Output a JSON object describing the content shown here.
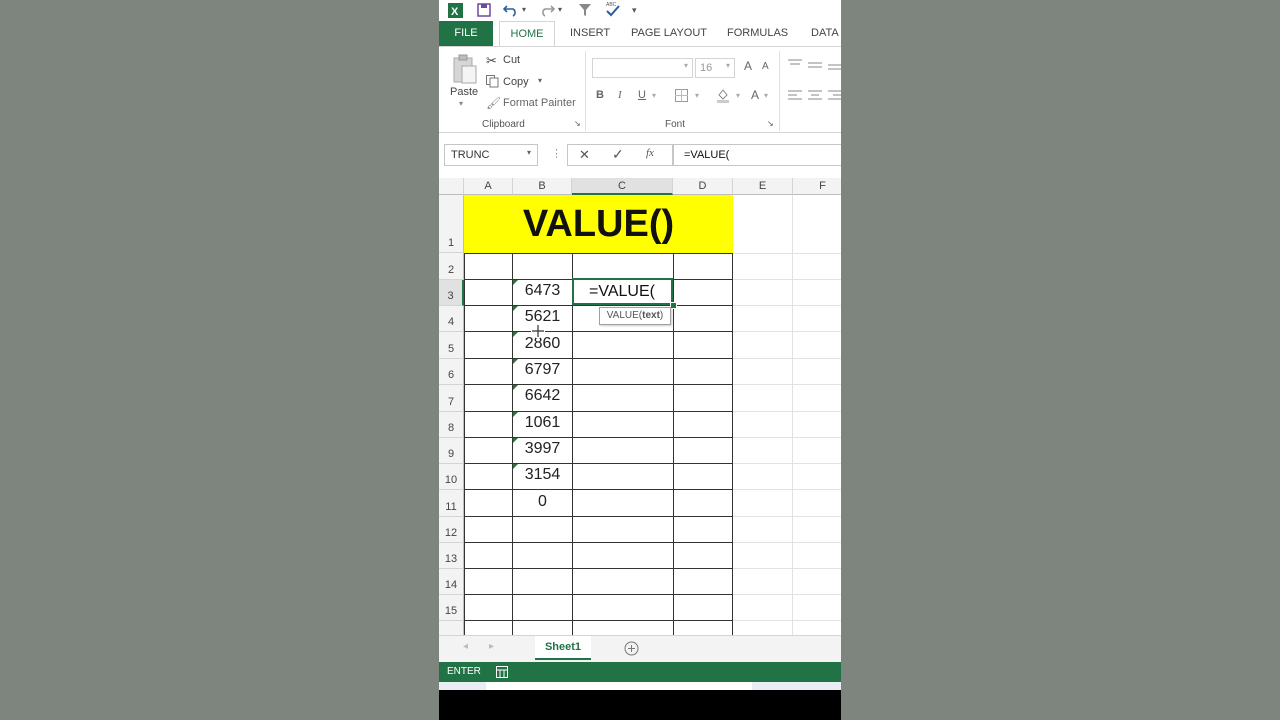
{
  "quick_access": {
    "excel_icon": "excel-logo-icon",
    "customize": "▾"
  },
  "tabs": [
    {
      "label": "FILE"
    },
    {
      "label": "HOME"
    },
    {
      "label": "INSERT"
    },
    {
      "label": "PAGE LAYOUT"
    },
    {
      "label": "FORMULAS"
    },
    {
      "label": "DATA"
    }
  ],
  "clipboard": {
    "paste": "Paste",
    "cut": "Cut",
    "copy": "Copy",
    "format_painter": "Format Painter",
    "group": "Clipboard"
  },
  "font": {
    "name": "",
    "size": "16",
    "bold": "B",
    "italic": "I",
    "underline": "U",
    "group": "Font",
    "grow": "A",
    "shrink": "A",
    "color": "A"
  },
  "formula_bar": {
    "name_box": "TRUNC",
    "formula": "=VALUE("
  },
  "columns": [
    "A",
    "B",
    "C",
    "D",
    "E",
    "F"
  ],
  "rows": [
    "1",
    "2",
    "3",
    "4",
    "5",
    "6",
    "7",
    "8",
    "9",
    "10",
    "11",
    "12",
    "13",
    "14",
    "15"
  ],
  "sheet": {
    "title": "VALUE()",
    "values": [
      "6473",
      "5621",
      "2860",
      "6797",
      "6642",
      "1061",
      "3997",
      "3154",
      "0"
    ],
    "active_cell_text": "=VALUE(",
    "tooltip_fn": "VALUE(",
    "tooltip_arg": "text",
    "tooltip_close": ")"
  },
  "sheet_tabs": {
    "active": "Sheet1"
  },
  "status": {
    "mode": "ENTER"
  },
  "colors": {
    "excel_green": "#217346",
    "title_fill": "#ffff00"
  }
}
